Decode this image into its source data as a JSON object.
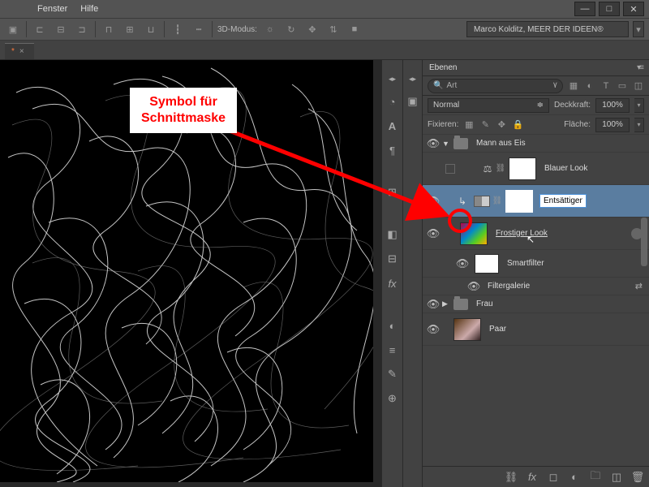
{
  "menu": {
    "fenster": "Fenster",
    "hilfe": "Hilfe"
  },
  "window_controls": {
    "min": "—",
    "max": "□",
    "close": "✕"
  },
  "optbar": {
    "mode3d_label": "3D-Modus:"
  },
  "workspace": {
    "label": "Marco Kolditz, MEER DER IDEEN®"
  },
  "tab": {
    "dirty": "*",
    "close": "×"
  },
  "callout": {
    "line1": "Symbol für",
    "line2": "Schnittmaske"
  },
  "panel": {
    "title": "Ebenen",
    "search_placeholder": "Art",
    "blend_mode": "Normal",
    "opacity_label": "Deckkraft:",
    "opacity_value": "100%",
    "lock_label": "Fixieren:",
    "fill_label": "Fläche:",
    "fill_value": "100%"
  },
  "layers": {
    "group1": "Mann aus Eis",
    "blauer": "Blauer Look",
    "entsaettigen": "Entsättigen",
    "frostiger": "Frostiger Look",
    "smartfilter": "Smartfilter",
    "filtergalerie": "Filtergalerie",
    "group2": "Frau",
    "paar": "Paar"
  }
}
